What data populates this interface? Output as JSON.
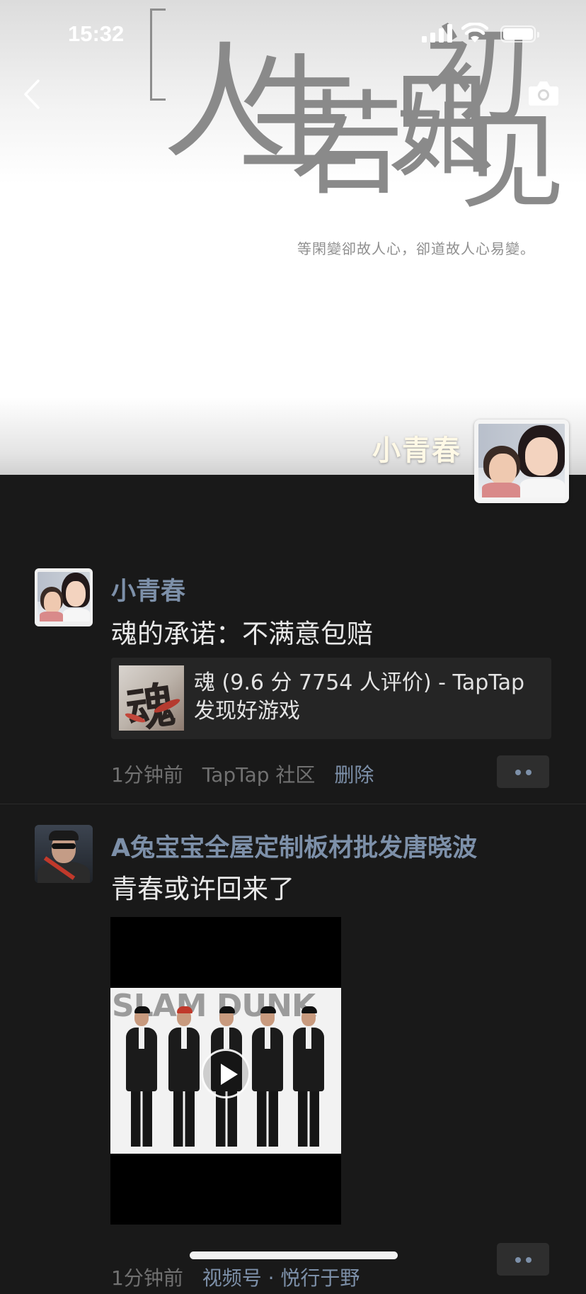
{
  "status_bar": {
    "time": "15:32"
  },
  "cover": {
    "title_chars": [
      "人",
      "生",
      "若",
      "只",
      "如",
      "初",
      "见"
    ],
    "subtitle": "等閑變卻故人心，卻道故人心易變。"
  },
  "profile": {
    "name": "小青春"
  },
  "posts": [
    {
      "author": "小青春",
      "text": "魂的承诺：不满意包赔",
      "link": {
        "thumb_glyph": "魂",
        "title": "魂 (9.6 分 7754 人评价) - TapTap 发现好游戏"
      },
      "meta": {
        "time": "1分钟前",
        "source": "TapTap 社区",
        "delete": "删除"
      }
    },
    {
      "author": "A兔宝宝全屋定制板材批发唐晓波",
      "text": "青春或许回来了",
      "video": {
        "poster_title": "SLAM DUNK"
      },
      "meta": {
        "time": "1分钟前",
        "source": "视频号 · 悦行于野"
      }
    }
  ],
  "icons": {
    "back": "chevron-left-icon",
    "camera": "camera-icon",
    "more": "more-dots-icon",
    "play": "play-icon"
  },
  "colors": {
    "background": "#191919",
    "author_name": "#7d90a9",
    "link_card": "#252525"
  }
}
